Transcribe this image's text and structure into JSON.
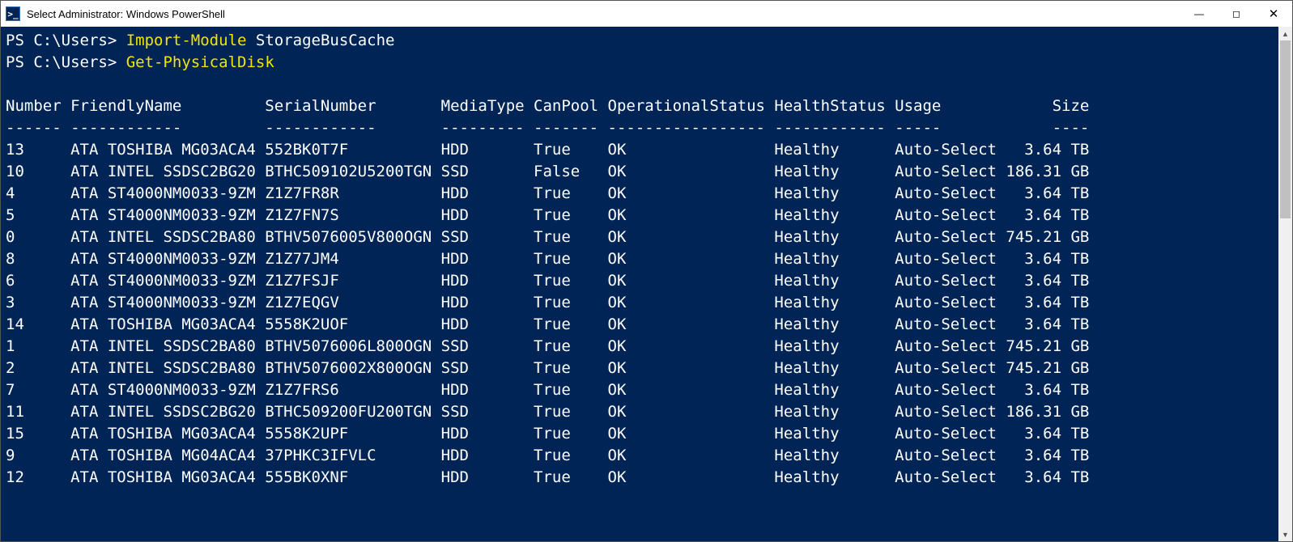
{
  "window": {
    "title": "Select Administrator: Windows PowerShell"
  },
  "prompt": "PS C:\\Users>",
  "commands": {
    "cmd1": "Import-Module",
    "arg1": "StorageBusCache",
    "cmd2": "Get-PhysicalDisk"
  },
  "headers": [
    "Number",
    "FriendlyName",
    "SerialNumber",
    "MediaType",
    "CanPool",
    "OperationalStatus",
    "HealthStatus",
    "Usage",
    "Size"
  ],
  "header_underlines": [
    "------",
    "------------",
    "------------",
    "---------",
    "-------",
    "-----------------",
    "------------",
    "-----",
    "----"
  ],
  "rows": [
    {
      "Number": "13",
      "FriendlyName": "ATA TOSHIBA MG03ACA4",
      "SerialNumber": "552BK0T7F",
      "MediaType": "HDD",
      "CanPool": "True",
      "OperationalStatus": "OK",
      "HealthStatus": "Healthy",
      "Usage": "Auto-Select",
      "Size": "3.64 TB"
    },
    {
      "Number": "10",
      "FriendlyName": "ATA INTEL SSDSC2BG20",
      "SerialNumber": "BTHC509102U5200TGN",
      "MediaType": "SSD",
      "CanPool": "False",
      "OperationalStatus": "OK",
      "HealthStatus": "Healthy",
      "Usage": "Auto-Select",
      "Size": "186.31 GB"
    },
    {
      "Number": "4",
      "FriendlyName": "ATA ST4000NM0033-9ZM",
      "SerialNumber": "Z1Z7FR8R",
      "MediaType": "HDD",
      "CanPool": "True",
      "OperationalStatus": "OK",
      "HealthStatus": "Healthy",
      "Usage": "Auto-Select",
      "Size": "3.64 TB"
    },
    {
      "Number": "5",
      "FriendlyName": "ATA ST4000NM0033-9ZM",
      "SerialNumber": "Z1Z7FN7S",
      "MediaType": "HDD",
      "CanPool": "True",
      "OperationalStatus": "OK",
      "HealthStatus": "Healthy",
      "Usage": "Auto-Select",
      "Size": "3.64 TB"
    },
    {
      "Number": "0",
      "FriendlyName": "ATA INTEL SSDSC2BA80",
      "SerialNumber": "BTHV5076005V800OGN",
      "MediaType": "SSD",
      "CanPool": "True",
      "OperationalStatus": "OK",
      "HealthStatus": "Healthy",
      "Usage": "Auto-Select",
      "Size": "745.21 GB"
    },
    {
      "Number": "8",
      "FriendlyName": "ATA ST4000NM0033-9ZM",
      "SerialNumber": "Z1Z77JM4",
      "MediaType": "HDD",
      "CanPool": "True",
      "OperationalStatus": "OK",
      "HealthStatus": "Healthy",
      "Usage": "Auto-Select",
      "Size": "3.64 TB"
    },
    {
      "Number": "6",
      "FriendlyName": "ATA ST4000NM0033-9ZM",
      "SerialNumber": "Z1Z7FSJF",
      "MediaType": "HDD",
      "CanPool": "True",
      "OperationalStatus": "OK",
      "HealthStatus": "Healthy",
      "Usage": "Auto-Select",
      "Size": "3.64 TB"
    },
    {
      "Number": "3",
      "FriendlyName": "ATA ST4000NM0033-9ZM",
      "SerialNumber": "Z1Z7EQGV",
      "MediaType": "HDD",
      "CanPool": "True",
      "OperationalStatus": "OK",
      "HealthStatus": "Healthy",
      "Usage": "Auto-Select",
      "Size": "3.64 TB"
    },
    {
      "Number": "14",
      "FriendlyName": "ATA TOSHIBA MG03ACA4",
      "SerialNumber": "5558K2UOF",
      "MediaType": "HDD",
      "CanPool": "True",
      "OperationalStatus": "OK",
      "HealthStatus": "Healthy",
      "Usage": "Auto-Select",
      "Size": "3.64 TB"
    },
    {
      "Number": "1",
      "FriendlyName": "ATA INTEL SSDSC2BA80",
      "SerialNumber": "BTHV5076006L800OGN",
      "MediaType": "SSD",
      "CanPool": "True",
      "OperationalStatus": "OK",
      "HealthStatus": "Healthy",
      "Usage": "Auto-Select",
      "Size": "745.21 GB"
    },
    {
      "Number": "2",
      "FriendlyName": "ATA INTEL SSDSC2BA80",
      "SerialNumber": "BTHV5076002X800OGN",
      "MediaType": "SSD",
      "CanPool": "True",
      "OperationalStatus": "OK",
      "HealthStatus": "Healthy",
      "Usage": "Auto-Select",
      "Size": "745.21 GB"
    },
    {
      "Number": "7",
      "FriendlyName": "ATA ST4000NM0033-9ZM",
      "SerialNumber": "Z1Z7FRS6",
      "MediaType": "HDD",
      "CanPool": "True",
      "OperationalStatus": "OK",
      "HealthStatus": "Healthy",
      "Usage": "Auto-Select",
      "Size": "3.64 TB"
    },
    {
      "Number": "11",
      "FriendlyName": "ATA INTEL SSDSC2BG20",
      "SerialNumber": "BTHC509200FU200TGN",
      "MediaType": "SSD",
      "CanPool": "True",
      "OperationalStatus": "OK",
      "HealthStatus": "Healthy",
      "Usage": "Auto-Select",
      "Size": "186.31 GB"
    },
    {
      "Number": "15",
      "FriendlyName": "ATA TOSHIBA MG03ACA4",
      "SerialNumber": "5558K2UPF",
      "MediaType": "HDD",
      "CanPool": "True",
      "OperationalStatus": "OK",
      "HealthStatus": "Healthy",
      "Usage": "Auto-Select",
      "Size": "3.64 TB"
    },
    {
      "Number": "9",
      "FriendlyName": "ATA TOSHIBA MG04ACA4",
      "SerialNumber": "37PHKC3IFVLC",
      "MediaType": "HDD",
      "CanPool": "True",
      "OperationalStatus": "OK",
      "HealthStatus": "Healthy",
      "Usage": "Auto-Select",
      "Size": "3.64 TB"
    },
    {
      "Number": "12",
      "FriendlyName": "ATA TOSHIBA MG03ACA4",
      "SerialNumber": "555BK0XNF",
      "MediaType": "HDD",
      "CanPool": "True",
      "OperationalStatus": "OK",
      "HealthStatus": "Healthy",
      "Usage": "Auto-Select",
      "Size": "3.64 TB"
    }
  ],
  "col_widths": {
    "Number": 7,
    "FriendlyName": 21,
    "SerialNumber": 19,
    "MediaType": 10,
    "CanPool": 8,
    "OperationalStatus": 18,
    "HealthStatus": 13,
    "Usage": 12,
    "Size": 9
  }
}
